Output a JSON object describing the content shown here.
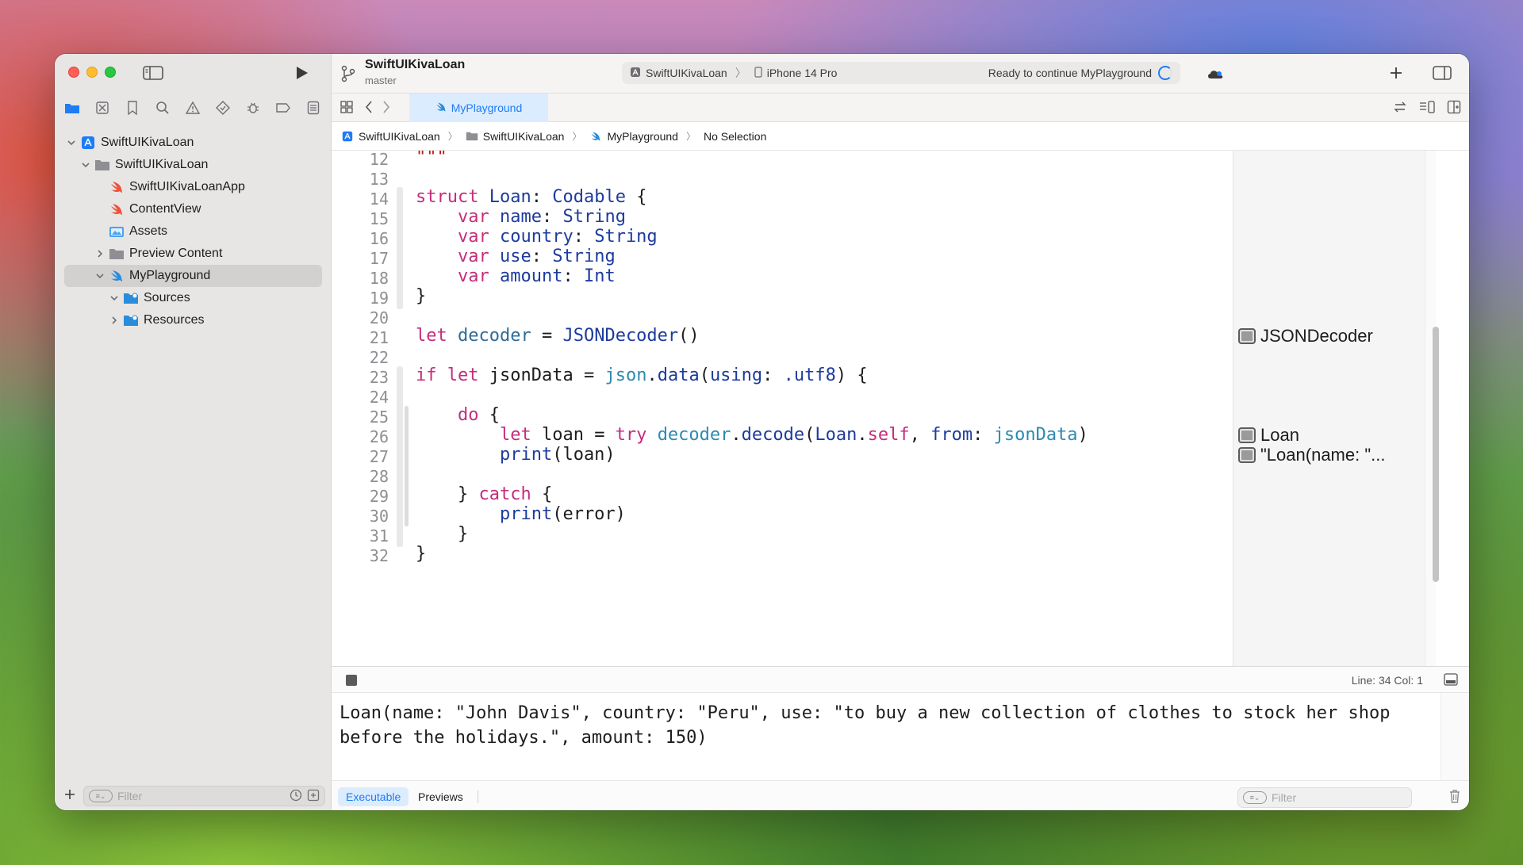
{
  "window": {
    "project": "SwiftUIKivaLoan",
    "branch": "master"
  },
  "scheme": {
    "target": "SwiftUIKivaLoan",
    "device": "iPhone 14 Pro",
    "status": "Ready to continue MyPlayground"
  },
  "tab": {
    "active": "MyPlayground"
  },
  "breadcrumb": [
    "SwiftUIKivaLoan",
    "SwiftUIKivaLoan",
    "MyPlayground",
    "No Selection"
  ],
  "navigator": {
    "items": [
      {
        "label": "SwiftUIKivaLoan",
        "icon": "app-project-icon"
      },
      {
        "label": "SwiftUIKivaLoan",
        "icon": "folder-icon"
      },
      {
        "label": "SwiftUIKivaLoanApp",
        "icon": "swift-file-icon"
      },
      {
        "label": "ContentView",
        "icon": "swift-file-icon"
      },
      {
        "label": "Assets",
        "icon": "assets-icon"
      },
      {
        "label": "Preview Content",
        "icon": "folder-icon"
      },
      {
        "label": "MyPlayground",
        "icon": "playground-icon"
      },
      {
        "label": "Sources",
        "icon": "blue-folder-icon"
      },
      {
        "label": "Resources",
        "icon": "blue-folder-icon"
      }
    ],
    "filter_placeholder": "Filter"
  },
  "editor": {
    "line_numbers": [
      "12",
      "13",
      "14",
      "15",
      "16",
      "17",
      "18",
      "19",
      "20",
      "21",
      "22",
      "23",
      "24",
      "25",
      "26",
      "27",
      "28",
      "29",
      "30",
      "31",
      "32"
    ],
    "lines": {
      "l12": "\"\"\"",
      "l14_kw": "struct",
      "l14_name": "Loan",
      "l14_type": "Codable",
      "l14_brace": "{",
      "l15_kw": "var",
      "l15_name": "name",
      "l15_type": "String",
      "l16_kw": "var",
      "l16_name": "country",
      "l16_type": "String",
      "l17_kw": "var",
      "l17_name": "use",
      "l17_type": "String",
      "l18_kw": "var",
      "l18_name": "amount",
      "l18_type": "Int",
      "l19": "}",
      "l21_kw": "let",
      "l21_name": "decoder",
      "l21_eq": " = ",
      "l21_type": "JSONDecoder",
      "l21_paren": "()",
      "l23_kw1": "if",
      "l23_kw2": "let",
      "l23_var": "jsonData",
      "l23_eq": " = ",
      "l23_json": "json",
      "l23_dot": ".",
      "l23_fn": "data",
      "l23_open": "(",
      "l23_arg": "using",
      "l23_colon": ": ",
      "l23_utf": ".utf8",
      "l23_close": ") {",
      "l25_kw": "do",
      "l25_brace": " {",
      "l26_kw": "let",
      "l26_var": " loan = ",
      "l26_try": "try",
      "l26_dec": "decoder",
      "l26_dot": ".",
      "l26_fn": "decode",
      "l26_open": "(",
      "l26_loan": "Loan",
      "l26_self": "self",
      "l26_comma": ", ",
      "l26_from": "from",
      "l26_colon": ": ",
      "l26_json": "jsonData",
      "l26_close": ")",
      "l27_fn": "print",
      "l27_rest": "(loan)",
      "l29_brace": "} ",
      "l29_kw": "catch",
      "l29_open": " {",
      "l30_fn": "print",
      "l30_rest": "(error)",
      "l31": "}",
      "l32": "}"
    }
  },
  "results": {
    "r21": "JSONDecoder",
    "r26": "Loan",
    "r27": "\"Loan(name: \"..."
  },
  "console": {
    "line_col": "Line: 34  Col: 1",
    "output": "Loan(name: \"John Davis\", country: \"Peru\", use: \"to buy a new collection of clothes to stock her shop before the holidays.\", amount: 150)",
    "tabs": {
      "executable": "Executable",
      "previews": "Previews"
    },
    "filter_placeholder": "Filter"
  },
  "colors": {
    "keyword": "#c52d7b",
    "type": "#1d3b9d",
    "property": "#2f6c96",
    "accent": "#1e7cf5"
  }
}
